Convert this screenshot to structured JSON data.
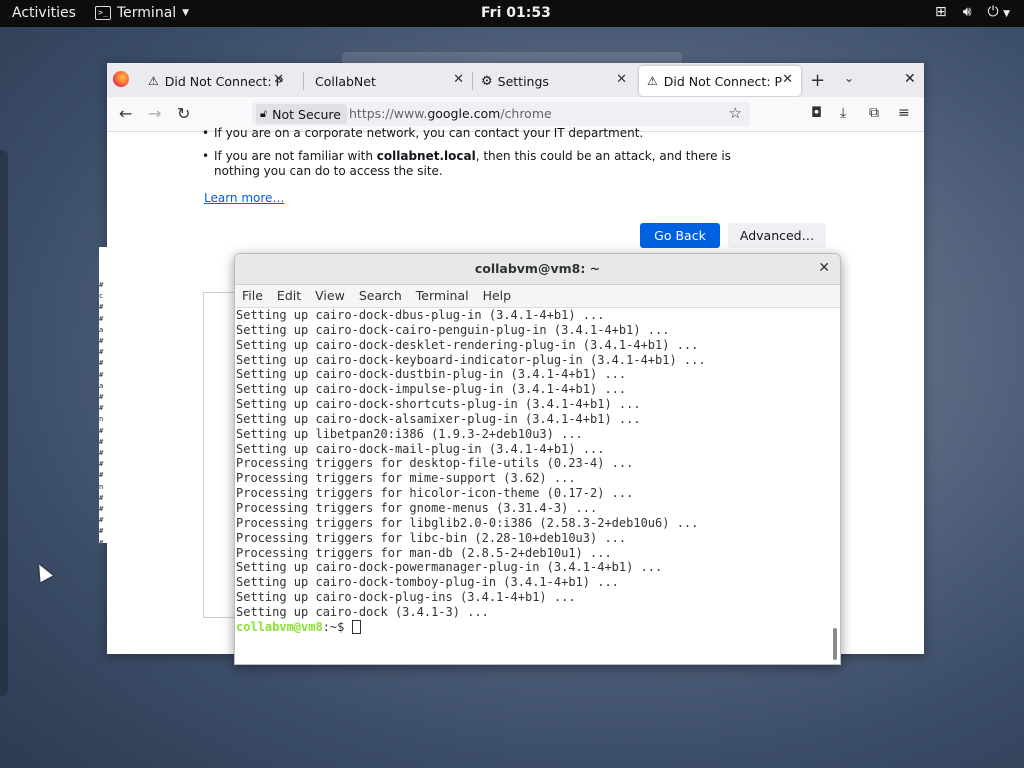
{
  "topbar": {
    "activities": "Activities",
    "app_name": "Terminal",
    "clock": "Fri 01:53"
  },
  "browser": {
    "tabs": [
      {
        "label": "Did Not Connect: Pote",
        "icon": "warning-icon"
      },
      {
        "label": "CollabNet",
        "icon": ""
      },
      {
        "label": "Settings",
        "icon": "gear-icon"
      },
      {
        "label": "Did Not Connect: Pote",
        "icon": "warning-icon"
      }
    ],
    "security_label": "Not Secure",
    "url_prefix": "https://www.",
    "url_domain": "google.com",
    "url_path": "/chrome",
    "page": {
      "bullet1": "If you are on a corporate network, you can contact your IT department.",
      "bullet2_pre": "If you are not familiar with ",
      "bullet2_bold": "collabnet.local",
      "bullet2_post": ", then this could be an attack, and there is nothing you can do to access the site.",
      "learn_more": "Learn more…",
      "go_back": "Go Back",
      "advanced": "Advanced…"
    }
  },
  "terminal": {
    "title": "collabvm@vm8: ~",
    "menu": [
      "File",
      "Edit",
      "View",
      "Search",
      "Terminal",
      "Help"
    ],
    "lines": [
      "Setting up cairo-dock-dbus-plug-in (3.4.1-4+b1) ...",
      "Setting up cairo-dock-cairo-penguin-plug-in (3.4.1-4+b1) ...",
      "Setting up cairo-dock-desklet-rendering-plug-in (3.4.1-4+b1) ...",
      "Setting up cairo-dock-keyboard-indicator-plug-in (3.4.1-4+b1) ...",
      "Setting up cairo-dock-dustbin-plug-in (3.4.1-4+b1) ...",
      "Setting up cairo-dock-impulse-plug-in (3.4.1-4+b1) ...",
      "Setting up cairo-dock-shortcuts-plug-in (3.4.1-4+b1) ...",
      "Setting up cairo-dock-alsamixer-plug-in (3.4.1-4+b1) ...",
      "Setting up libetpan20:i386 (1.9.3-2+deb10u3) ...",
      "Setting up cairo-dock-mail-plug-in (3.4.1-4+b1) ...",
      "Processing triggers for desktop-file-utils (0.23-4) ...",
      "Processing triggers for mime-support (3.62) ...",
      "Processing triggers for hicolor-icon-theme (0.17-2) ...",
      "Processing triggers for gnome-menus (3.31.4-3) ...",
      "Processing triggers for libglib2.0-0:i386 (2.58.3-2+deb10u6) ...",
      "Processing triggers for libc-bin (2.28-10+deb10u3) ...",
      "Processing triggers for man-db (2.8.5-2+deb10u1) ...",
      "Setting up cairo-dock-powermanager-plug-in (3.4.1-4+b1) ...",
      "Setting up cairo-dock-tomboy-plug-in (3.4.1-4+b1) ...",
      "Setting up cairo-dock-plug-ins (3.4.1-4+b1) ...",
      "Setting up cairo-dock (3.4.1-3) ..."
    ],
    "prompt_user": "collabvm@vm8",
    "prompt_path": ":~$ "
  },
  "peek_window": {
    "chars": [
      "#",
      "c",
      "#",
      "#",
      "a",
      "#",
      "#",
      "#",
      "#",
      "a",
      "#",
      "#",
      "n",
      "#",
      "#",
      "#",
      "#",
      "#",
      "n",
      "#",
      "#",
      "#",
      "#",
      "#",
      "c"
    ]
  },
  "colors": {
    "accent": "#0061e0",
    "prompt_user": "#8ae234",
    "prompt_path": "#729fcf"
  }
}
